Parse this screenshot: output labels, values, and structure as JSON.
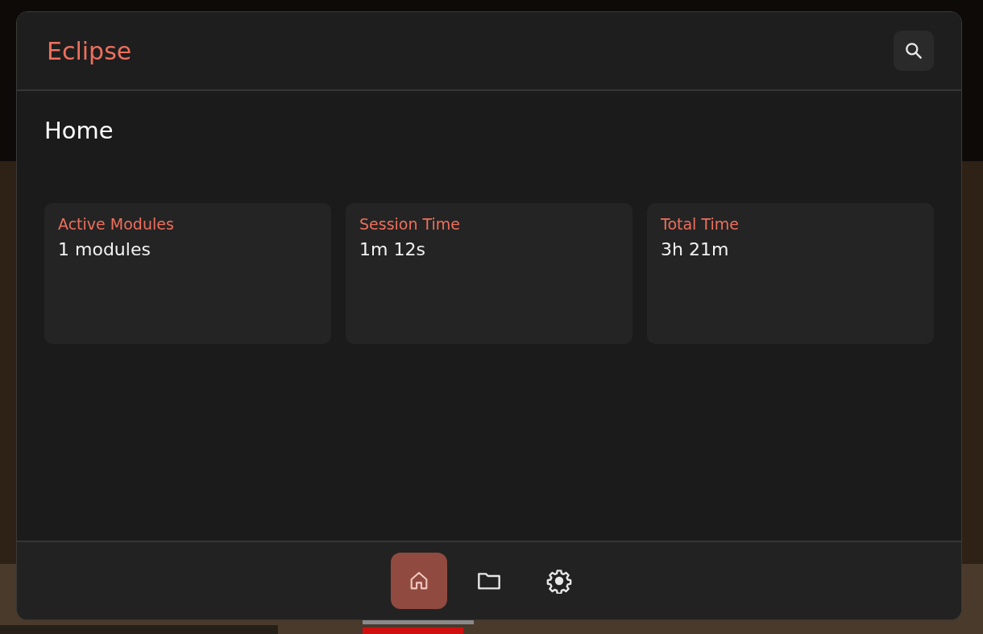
{
  "header": {
    "title": "Eclipse"
  },
  "page": {
    "title": "Home"
  },
  "stats": [
    {
      "label": "Active Modules",
      "value": "1 modules"
    },
    {
      "label": "Session Time",
      "value": "1m 12s"
    },
    {
      "label": "Total Time",
      "value": "3h 21m"
    }
  ],
  "nav": [
    {
      "kind": "home",
      "selected": true
    },
    {
      "kind": "folder",
      "selected": false
    },
    {
      "kind": "settings",
      "selected": false
    }
  ]
}
